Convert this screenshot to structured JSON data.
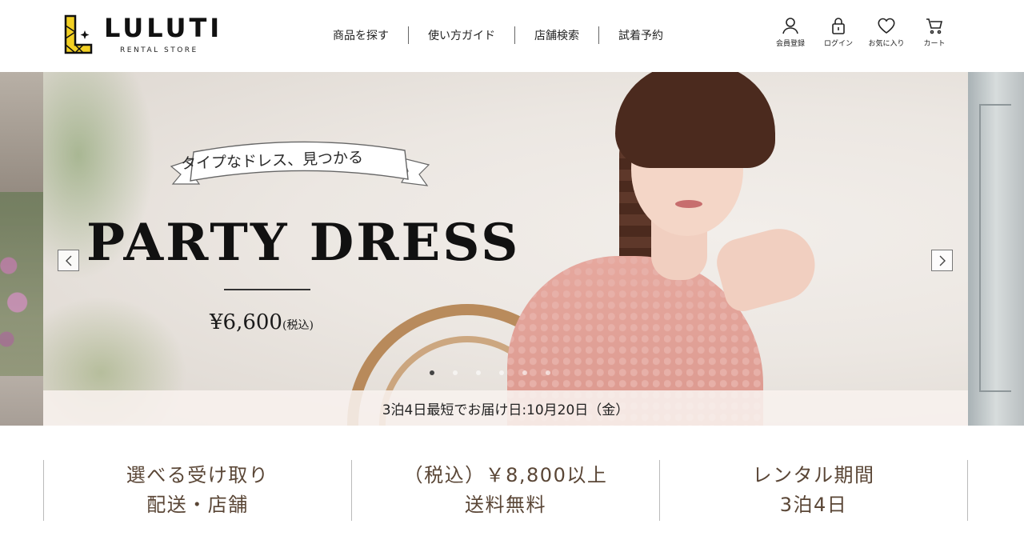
{
  "header": {
    "logo_text": "LULUTI",
    "logo_sub": "RENTAL STORE",
    "nav": [
      {
        "label": "商品を探す"
      },
      {
        "label": "使い方ガイド"
      },
      {
        "label": "店舗検索"
      },
      {
        "label": "試着予約"
      }
    ],
    "utils": [
      {
        "label": "会員登録",
        "icon": "user-icon"
      },
      {
        "label": "ログイン",
        "icon": "lock-icon"
      },
      {
        "label": "お気に入り",
        "icon": "heart-icon"
      },
      {
        "label": "カート",
        "icon": "cart-icon"
      }
    ]
  },
  "hero": {
    "ribbon_text": "タイプなドレス、見つかる",
    "headline": "PARTY DRESS",
    "price": "¥6,600",
    "price_note": "(税込)",
    "slide_count": 6,
    "active_slide": 1,
    "delivery_text": "3泊4日最短でお届け日:10月20日（金）"
  },
  "features": [
    {
      "line1": "選べる受け取り",
      "line2": "配送・店舗"
    },
    {
      "line1": "（税込）￥8,800以上",
      "line2": "送料無料"
    },
    {
      "line1": "レンタル期間",
      "line2": "3泊4日"
    }
  ],
  "colors": {
    "logo_yellow": "#f2d024",
    "feature_text": "#5a4636",
    "dress_pink": "#e6a89e"
  }
}
